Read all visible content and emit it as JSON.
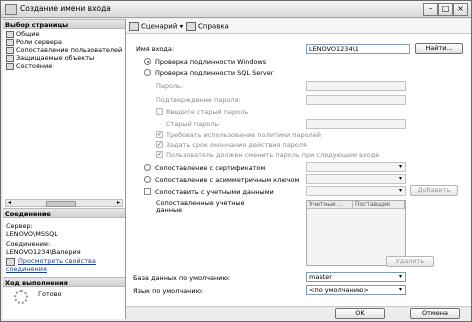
{
  "window": {
    "title": "Создание имени входа"
  },
  "sidebar": {
    "page_select_header": "Выбор страницы",
    "pages": [
      "Общие",
      "Роли сервера",
      "Сопоставление пользователей",
      "Защищаемые объекты",
      "Состояние"
    ],
    "connection_header": "Соединение",
    "server_label": "Сервер:",
    "server_value": "LENOVO\\MSSQL",
    "conn_label": "Соединение:",
    "conn_value": "LENOVO1234\\Валерия",
    "view_props_link": "Просмотреть свойства соединения",
    "progress_header": "Ход выполнения",
    "progress_status": "Готово"
  },
  "toolbar": {
    "script_label": "Сценарий",
    "help_label": "Справка"
  },
  "form": {
    "login_label": "Имя входа:",
    "login_value": "LENOVO1234\\1",
    "find_button": "Найти...",
    "win_auth": "Проверка подлинности Windows",
    "sql_auth": "Проверка подлинности SQL Server",
    "password_label": "Пароль:",
    "confirm_label": "Подтверждение пароля:",
    "old_pw_check": "Введите старый пароль",
    "old_pw_label": "Старый пароль:",
    "enforce_policy": "Требовать использование политики паролей",
    "enforce_expiration": "Задать срок окончания действия пароля",
    "must_change": "Пользователь должен сменить пароль при следующем входе",
    "cert_mapping": "Сопоставление с сертификатом",
    "asym_mapping": "Сопоставление с асимметричным ключом",
    "cred_mapping": "Сопоставить с учетными данными",
    "add_button": "Добавить",
    "mapped_creds_label": "Сопоставленные учетные данные",
    "grid_col_cred": "Учетные ...",
    "grid_col_provider": "Поставщик",
    "remove_button": "Удалить",
    "default_db_label": "База данных по умолчанию:",
    "default_db_value": "master",
    "default_lang_label": "Язык по умолчанию:",
    "default_lang_value": "<по умолчанию>"
  },
  "footer": {
    "ok_button": "OK",
    "cancel_button": "Отмена"
  }
}
